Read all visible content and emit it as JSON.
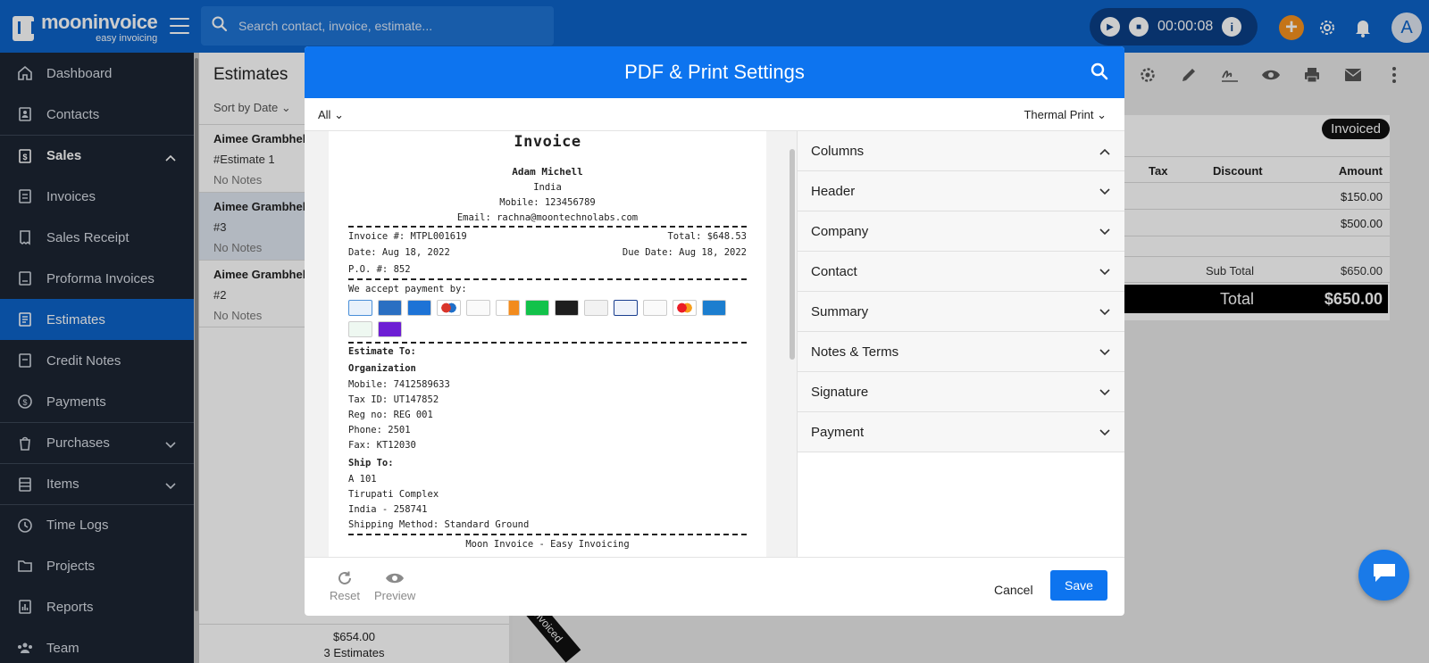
{
  "topbar": {
    "logo_name": "mooninvoice",
    "logo_tagline": "easy invoicing",
    "search_placeholder": "Search contact, invoice, estimate...",
    "timer": "00:00:08",
    "avatar_letter": "A"
  },
  "sidebar": {
    "items": [
      {
        "label": "Dashboard",
        "icon": "home-icon"
      },
      {
        "label": "Contacts",
        "icon": "contacts-icon"
      },
      {
        "label": "Sales",
        "icon": "sales-icon"
      },
      {
        "label": "Invoices",
        "icon": "invoice-icon"
      },
      {
        "label": "Sales Receipt",
        "icon": "receipt-icon"
      },
      {
        "label": "Proforma Invoices",
        "icon": "proforma-icon"
      },
      {
        "label": "Estimates",
        "icon": "estimate-icon"
      },
      {
        "label": "Credit Notes",
        "icon": "credit-note-icon"
      },
      {
        "label": "Payments",
        "icon": "payment-icon"
      },
      {
        "label": "Purchases",
        "icon": "purchase-icon"
      },
      {
        "label": "Items",
        "icon": "items-icon"
      },
      {
        "label": "Time Logs",
        "icon": "clock-icon"
      },
      {
        "label": "Projects",
        "icon": "folder-icon"
      },
      {
        "label": "Reports",
        "icon": "reports-icon"
      },
      {
        "label": "Team",
        "icon": "team-icon"
      }
    ]
  },
  "list": {
    "title": "Estimates",
    "sort_label": "Sort by Date",
    "rows": [
      {
        "name": "Aimee Grambhel",
        "number": "#Estimate 1",
        "notes": "No Notes"
      },
      {
        "name": "Aimee Grambhel",
        "number": "#3",
        "notes": "No Notes"
      },
      {
        "name": "Aimee Grambhel",
        "number": "#2",
        "notes": "No Notes"
      }
    ],
    "footer_total": "$654.00",
    "footer_count": "3 Estimates"
  },
  "detail": {
    "status": "Invoiced",
    "columns": {
      "tax": "Tax",
      "discount": "Discount",
      "amount": "Amount"
    },
    "row_amounts": [
      "$150.00",
      "$500.00"
    ],
    "subtotal_label": "Sub Total",
    "subtotal_value": "$650.00",
    "total_label": "Total",
    "total_value": "$650.00",
    "ribbon": "Invoiced"
  },
  "modal": {
    "title": "PDF & Print Settings",
    "filter_all": "All",
    "print_type": "Thermal Print",
    "sections": [
      "Columns",
      "Header",
      "Company",
      "Contact",
      "Summary",
      "Notes & Terms",
      "Signature",
      "Payment"
    ],
    "footer": {
      "reset": "Reset",
      "preview": "Preview",
      "cancel": "Cancel",
      "save": "Save"
    }
  },
  "preview": {
    "title": "Invoice",
    "company_name": "Adam Michell",
    "company_country": "India",
    "company_mobile": "Mobile: 123456789",
    "company_email": "Email: rachna@moontechnolabs.com",
    "invoice_no": "Invoice #: MTPL001619",
    "total": "Total: $648.53",
    "date": "Date: Aug 18, 2022",
    "due_date": "Due Date: Aug 18, 2022",
    "po": "P.O. #: 852",
    "payment_heading": "We accept payment by:",
    "payment_methods": [
      {
        "name": "bank-transfer-logo",
        "color": "#4a8fd8"
      },
      {
        "name": "american-express-logo",
        "color": "#2a6fc2"
      },
      {
        "name": "cash-logo",
        "color": "#1d73d6"
      },
      {
        "name": "maestro-logo",
        "color": "#d9352b"
      },
      {
        "name": "zettle-logo",
        "color": "#444444"
      },
      {
        "name": "discover-logo",
        "color": "#f28b1e"
      },
      {
        "name": "cash-app-logo",
        "color": "#12c24a"
      },
      {
        "name": "ubl-logo",
        "color": "#1e1e1e"
      },
      {
        "name": "sumup-logo",
        "color": "#555555"
      },
      {
        "name": "visa-logo",
        "color": "#1a3f8f"
      },
      {
        "name": "payoneer-logo",
        "color": "#bbbbbb"
      },
      {
        "name": "mastercard-logo",
        "color": "#eb5a28"
      },
      {
        "name": "khqr-logo",
        "color": "#1c7ecf"
      },
      {
        "name": "ecopayz-logo",
        "color": "#3aa35b"
      },
      {
        "name": "zelle-logo",
        "color": "#6d1ed4"
      }
    ],
    "estimate_to_heading": "Estimate To:",
    "organization": "Organization",
    "org_mobile": "Mobile: 7412589633",
    "org_tax": "Tax ID: UT147852",
    "org_reg": "Reg no: REG 001",
    "org_phone": "Phone: 2501",
    "org_fax": "Fax: KT12030",
    "ship_to_heading": "Ship To:",
    "ship_line1": "A 101",
    "ship_line2": "Tirupati Complex",
    "ship_line3": "India - 258741",
    "shipping_method": "Shipping Method: Standard Ground",
    "footer_brand": "Moon Invoice - Easy Invoicing"
  },
  "colors": {
    "brand_blue": "#0d63c9",
    "modal_header": "#0d74ef",
    "sidebar_bg": "#1c2532",
    "accent_orange": "#f5921e"
  }
}
